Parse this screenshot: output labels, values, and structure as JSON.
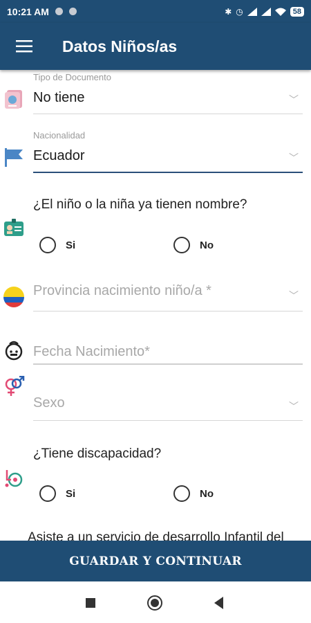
{
  "status_bar": {
    "time": "10:21 AM",
    "battery": "58"
  },
  "header": {
    "title": "Datos Niños/as"
  },
  "form": {
    "tipo_documento": {
      "label": "Tipo de Documento",
      "value": "No tiene"
    },
    "nacionalidad": {
      "label": "Nacionalidad",
      "value": "Ecuador"
    },
    "nombre_question": "¿El niño o la niña ya tienen nombre?",
    "nombre_options": [
      "Si",
      "No"
    ],
    "provincia": {
      "placeholder": "Provincia nacimiento niño/a *"
    },
    "fecha": {
      "placeholder": "Fecha Nacimiento*"
    },
    "sexo": {
      "placeholder": "Sexo"
    },
    "discapacidad_question": "¿Tiene discapacidad?",
    "discapacidad_options": [
      "Si",
      "No"
    ],
    "next_question": "Asiste a un servicio de desarrollo Infantil del"
  },
  "actions": {
    "save_label": "GUARDAR Y CONTINUAR"
  },
  "colors": {
    "primary": "#1f4d74",
    "underline_active": "#2a4f7a"
  },
  "icons": [
    "menu-icon",
    "passport-icon",
    "flag-icon",
    "id-card-icon",
    "ecuador-flag-icon",
    "baby-icon",
    "gender-icon",
    "wheelchair-icon"
  ]
}
